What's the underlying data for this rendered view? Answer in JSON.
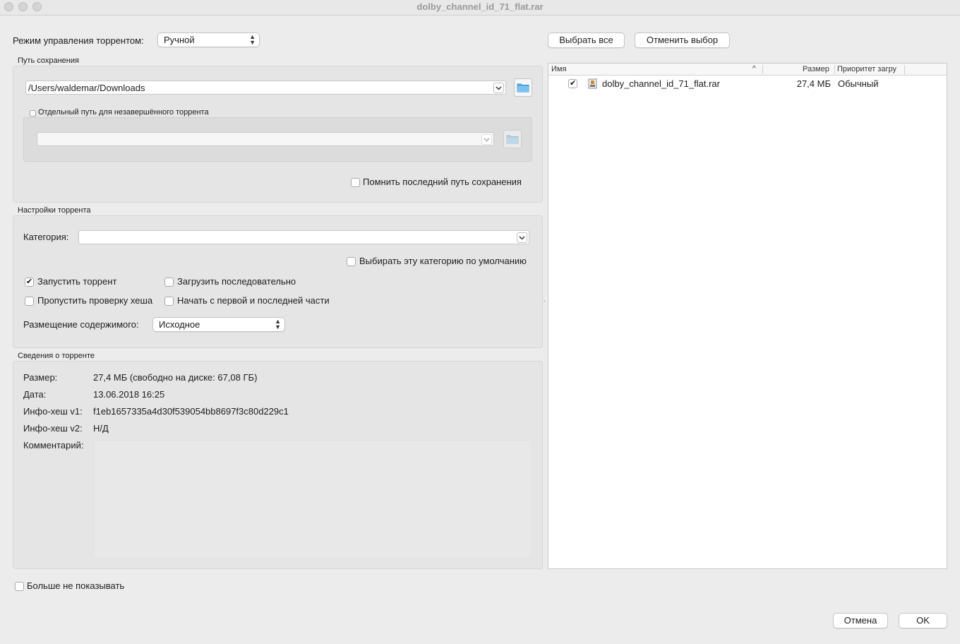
{
  "window": {
    "title": "dolby_channel_id_71_flat.rar"
  },
  "torrent_mode": {
    "label": "Режим управления торрентом:",
    "value": "Ручной"
  },
  "save_path": {
    "group_title": "Путь сохранения",
    "path_value": "/Users/waldemar/Downloads",
    "separate_path_label": "Отдельный путь для незавершённого торрента",
    "incomplete_path_value": "",
    "remember_label": "Помнить последний путь сохранения"
  },
  "torrent_settings": {
    "group_title": "Настройки торрента",
    "category_label": "Категория:",
    "category_value": "",
    "default_category_label": "Выбирать эту категорию по умолчанию",
    "start_torrent_label": "Запустить торрент",
    "sequential_label": "Загрузить последовательно",
    "skip_hash_label": "Пропустить проверку хеша",
    "first_last_label": "Начать с первой и последней части",
    "layout_label": "Размещение содержимого:",
    "layout_value": "Исходное"
  },
  "torrent_info": {
    "group_title": "Сведения о торренте",
    "size_label": "Размер:",
    "size_value": "27,4 МБ (свободно на диске: 67,08 ГБ)",
    "date_label": "Дата:",
    "date_value": "13.06.2018 16:25",
    "hash_v1_label": "Инфо-хеш v1:",
    "hash_v1_value": "f1eb1657335a4d30f539054bb8697f3c80d229c1",
    "hash_v2_label": "Инфо-хеш v2:",
    "hash_v2_value": "Н/Д",
    "comment_label": "Комментарий:",
    "comment_value": ""
  },
  "file_panel": {
    "select_all_label": "Выбрать все",
    "deselect_label": "Отменить выбор",
    "columns": {
      "name": "Имя",
      "size": "Размер",
      "priority": "Приоритет загру"
    },
    "files": [
      {
        "name": "dolby_channel_id_71_flat.rar",
        "size": "27,4 МБ",
        "priority": "Обычный",
        "checked": true
      }
    ]
  },
  "footer": {
    "dont_show_label": "Больше не показывать",
    "cancel_label": "Отмена",
    "ok_label": "OK"
  }
}
